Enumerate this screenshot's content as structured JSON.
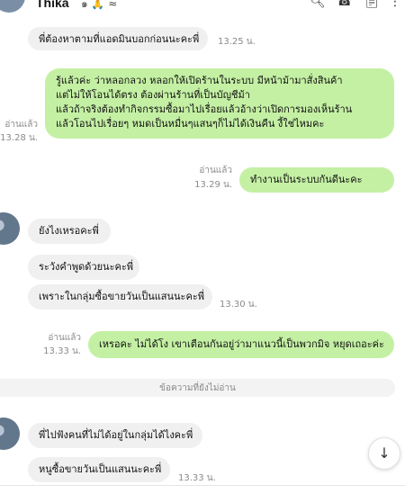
{
  "header": {
    "contact_name": "Thika",
    "name_extra": "๑ 🙏 ≈",
    "icons": [
      "search-icon",
      "call-icon",
      "notes-icon",
      "more-icon"
    ]
  },
  "messages": [
    {
      "text": "พี่ต้องหาตามที่แอดมินบอกก่อนนะคะพี่",
      "time": "13.25 น."
    },
    {
      "text": "รู้แล้วค่ะ ว่าหลอกลวง หลอกให้เปิดร้านในระบบ มีหน้าม้ามาสั่งสินค้า\nแต่ไม่ให้โอนได้ตรง ต้องผ่านร้านที่เป็นบัญชีม้า\nแล้วถ้าจริงต้องทำกิจกรรมซื้อมาไปเรื่อยแล้วอ้างว่าเปิดการมองเห็นร้าน\nแล้วโอนไปเรื่อยๆ หมดเป็นหมื่นๆแสนๆก็ไม่ได้เงินคืน งี้ใช่ไหมคะ",
      "read": "อ่านแล้ว",
      "time": "13.28 น."
    },
    {
      "text": "ทำงานเป็นระบบกันดีนะคะ",
      "read": "อ่านแล้ว",
      "time": "13.29 น."
    },
    {
      "text": "ยังไงเหรอคะพี่"
    },
    {
      "text": "ระวังคำพูดด้วยนะคะพี่"
    },
    {
      "text": "เพราะในกลุ่มซื้อขายวันเป็นแสนนะคะพี่",
      "time": "13.30 น."
    },
    {
      "text": "เหรอคะ ไม่ได้โง เขาเตือนกันอยู่ว่ามาแนวนี้เป็นพวกมิจ หยุดเถอะค่ะ",
      "read": "อ่านแล้ว",
      "time": "13.33 น."
    },
    {
      "text": "พี่ไปฟังคนที่ไม่ได้อยู่ในกลุ่มได้ไงคะพี่"
    },
    {
      "text": "หนูซื้อขายวันเป็นแสนนะคะพี่",
      "time": "13.33 น."
    }
  ],
  "unread_divider": "ข้อความที่ยังไม่อ่าน",
  "scroll_button_icon": "arrow-down-icon"
}
